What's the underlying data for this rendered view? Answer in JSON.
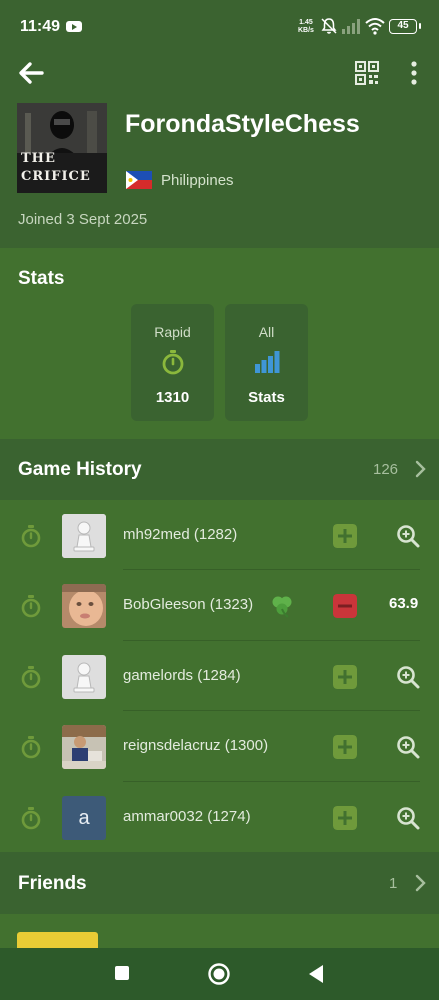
{
  "status_bar": {
    "time": "11:49",
    "speed_value": "1.45",
    "speed_unit": "KB/s",
    "battery": "45"
  },
  "profile": {
    "username": "ForondaStyleChess",
    "avatar_text": "THE CRIFICE",
    "country": "Philippines",
    "joined": "Joined 3 Sept 2025"
  },
  "stats": {
    "title": "Stats",
    "cards": [
      {
        "label": "Rapid",
        "value": "1310",
        "icon": "stopwatch-icon"
      },
      {
        "label": "All",
        "value": "Stats",
        "icon": "bar-chart-icon"
      }
    ]
  },
  "game_history": {
    "title": "Game History",
    "count": "126",
    "games": [
      {
        "opponent": "mh92med (1282)",
        "result": "win",
        "action": "analyze"
      },
      {
        "opponent": "BobGleeson (1323)",
        "result": "loss",
        "accuracy": "63.9",
        "badge": "clover-icon"
      },
      {
        "opponent": "gamelords (1284)",
        "result": "win",
        "action": "analyze"
      },
      {
        "opponent": "reignsdelacruz (1300)",
        "result": "win",
        "action": "analyze"
      },
      {
        "opponent": "ammar0032 (1274)",
        "result": "win",
        "action": "analyze",
        "avatar_letter": "a"
      }
    ]
  },
  "friends": {
    "title": "Friends",
    "count": "1"
  },
  "colors": {
    "header_bg": "#3b6330",
    "section_bg": "#42712f",
    "win": "#6f9a3b",
    "loss": "#c9353a",
    "accent_green": "#83b23b",
    "accent_blue": "#3f96d6"
  }
}
